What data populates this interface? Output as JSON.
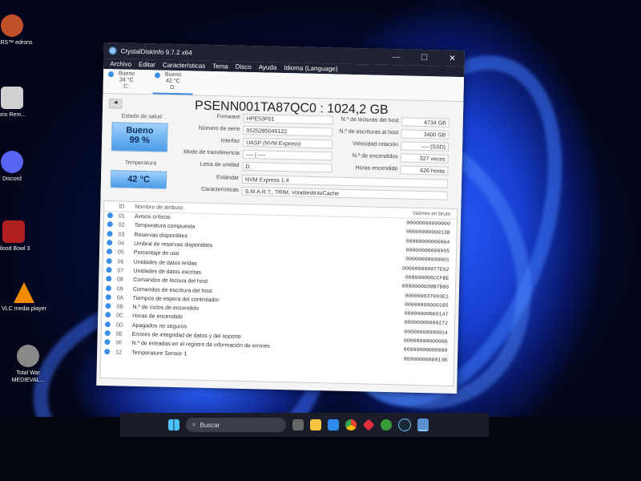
{
  "window": {
    "title": "CrystalDiskInfo 9.7.2 x64",
    "minimize": "—",
    "maximize": "☐",
    "close": "✕"
  },
  "menu": [
    "Archivo",
    "Editar",
    "Características",
    "Tema",
    "Disco",
    "Ayuda",
    "Idioma (Language)"
  ],
  "disk_tabs": [
    {
      "status": "Bueno",
      "temp": "34 °C",
      "letter": "C:"
    },
    {
      "status": "Bueno",
      "temp": "42 °C",
      "letter": "D:"
    }
  ],
  "disk": {
    "model": "PSENN001TA87QC0 : 1024,2 GB",
    "health_label": "Estado de salud",
    "health_status": "Bueno",
    "health_percent": "99 %",
    "temp_label": "Temperatura",
    "temp_value": "42 °C",
    "left_fields": [
      {
        "label": "Firmware",
        "value": "HPE53P01"
      },
      {
        "label": "Número de serie",
        "value": "0525285046122"
      },
      {
        "label": "Interfaz",
        "value": "UASP (NVM Express)"
      },
      {
        "label": "Modo de transferencia",
        "value": "---- | ----"
      },
      {
        "label": "Letra de unidad",
        "value": "D:"
      }
    ],
    "right_fields": [
      {
        "label": "N.º de lecturas del host",
        "value": "4734 GB"
      },
      {
        "label": "N.º de escrituras al host",
        "value": "3400 GB"
      },
      {
        "label": "Velocidad rotación",
        "value": "---- (SSD)"
      },
      {
        "label": "N.º de encendidos",
        "value": "327 veces"
      },
      {
        "label": "Horas encendido",
        "value": "626 horas"
      }
    ],
    "standard_label": "Estándar",
    "standard_value": "NVM Express 1.4",
    "features_label": "Características",
    "features_value": "S.M.A.R.T., TRIM, VolatileWriteCache"
  },
  "smart": {
    "headers": {
      "id": "ID",
      "name": "Nombre de atributo",
      "raw": "Valores en bruto"
    },
    "rows": [
      {
        "id": "01",
        "name": "Avisos críticos",
        "raw": "00000000000000"
      },
      {
        "id": "02",
        "name": "Temperatura compuesta",
        "raw": "0000000000013B"
      },
      {
        "id": "03",
        "name": "Reservas disponibles",
        "raw": "00000000000064"
      },
      {
        "id": "04",
        "name": "Umbral de reservas disponibles",
        "raw": "00000000000005"
      },
      {
        "id": "05",
        "name": "Porcentaje de uso",
        "raw": "00000000000001"
      },
      {
        "id": "06",
        "name": "Unidades de datos leídas",
        "raw": "000000000977E62"
      },
      {
        "id": "07",
        "name": "Unidades de datos escritas",
        "raw": "000000006CCFBE"
      },
      {
        "id": "08",
        "name": "Comandos de lectura del host",
        "raw": "0000000038B7B80"
      },
      {
        "id": "09",
        "name": "Comandos de escritura del host",
        "raw": "000000037093E1"
      },
      {
        "id": "0A",
        "name": "Tiempos de espera del controlador",
        "raw": "00000000000185"
      },
      {
        "id": "0B",
        "name": "N.º de ciclos de encendido",
        "raw": "00000000000147"
      },
      {
        "id": "0C",
        "name": "Horas de encendido",
        "raw": "00000000000272"
      },
      {
        "id": "0D",
        "name": "Apagados no seguros",
        "raw": "00000000000014"
      },
      {
        "id": "0E",
        "name": "Errores de integridad de datos y del soporte",
        "raw": "00000000000000"
      },
      {
        "id": "0F",
        "name": "N.º de entradas en el registro de información de errores",
        "raw": "00000000000000"
      },
      {
        "id": "12",
        "name": "Temperature Sensor 1",
        "raw": "0000000000013B"
      }
    ]
  },
  "desktop_icons": [
    {
      "label": "WARS™ edrons",
      "color": "#c0502a"
    },
    {
      "label": "orio Rem...",
      "color": "#d0d0d0"
    },
    {
      "label": "Discord",
      "color": "#5865f2"
    },
    {
      "label": "Blood Bowl 3",
      "color": "#b02020"
    },
    {
      "label": "VLC media player",
      "color": "#f08a00"
    },
    {
      "label": "Total War MEDIEVAL...",
      "color": "#888888"
    }
  ],
  "taskbar": {
    "search_placeholder": "Buscar"
  }
}
